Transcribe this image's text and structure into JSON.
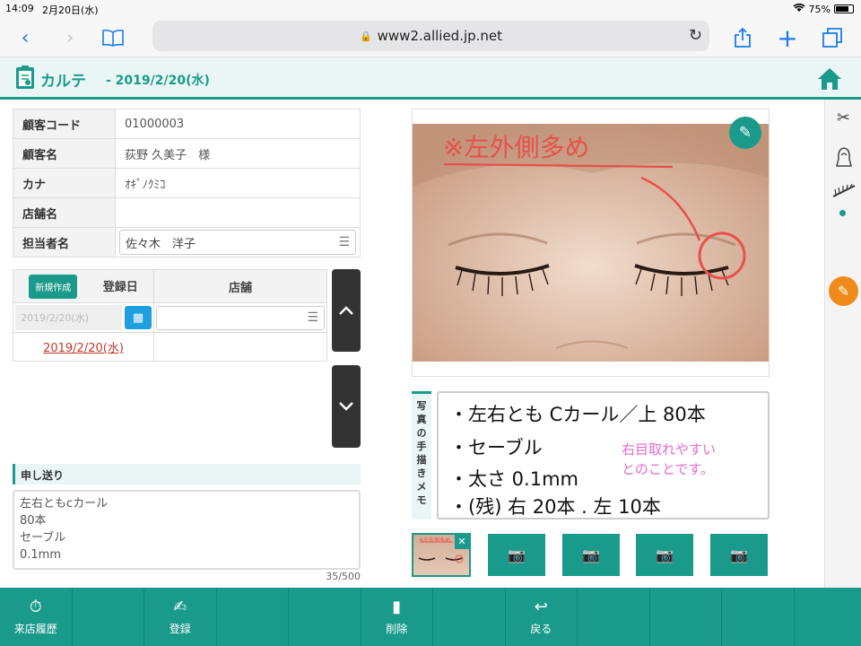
{
  "status": {
    "time": "14:09",
    "date": "2月20日(水)",
    "battery": "75%",
    "battery_level": 0.75
  },
  "browser": {
    "url": "www2.allied.jp.net"
  },
  "header": {
    "title": "カルテ",
    "date": "- 2019/2/20(水)"
  },
  "customer": {
    "rows": [
      {
        "key": "顧客コード",
        "value": "01000003"
      },
      {
        "key": "顧客名",
        "value": "荻野 久美子　様"
      },
      {
        "key": "カナ",
        "value": "ｵｷﾞﾉｸﾐｺ"
      },
      {
        "key": "店舗名",
        "value": ""
      }
    ],
    "staff_label": "担当者名",
    "staff_value": "佐々木　洋子"
  },
  "visits": {
    "new_button": "新規作成",
    "col_date": "登録日",
    "col_store": "店舗",
    "date_input": "2019/2/20(水)",
    "entry_date": "2019/2/20(水)"
  },
  "memo": {
    "label": "申し送り",
    "lines": [
      "左右ともcカール",
      "80本",
      "セーブル",
      "0.1mm"
    ],
    "count": "35/500"
  },
  "photo": {
    "annotation": "※左外側多め"
  },
  "hand_memo": {
    "tab_label": [
      "写",
      "真",
      "の",
      "手",
      "描",
      "き",
      "メ",
      "モ"
    ],
    "lines": [
      "・左右とも Cカール／上 80本",
      "・セーブル",
      "・太さ 0.1mm",
      "・(残) 右 20本 . 左 10本"
    ],
    "pink_note": [
      "右目取れやすい",
      "とのことです。"
    ],
    "thumb_label": "※左外側多め"
  },
  "toolbar": {
    "history": "来店履歴",
    "register": "登録",
    "delete": "削除",
    "back": "戻る"
  }
}
